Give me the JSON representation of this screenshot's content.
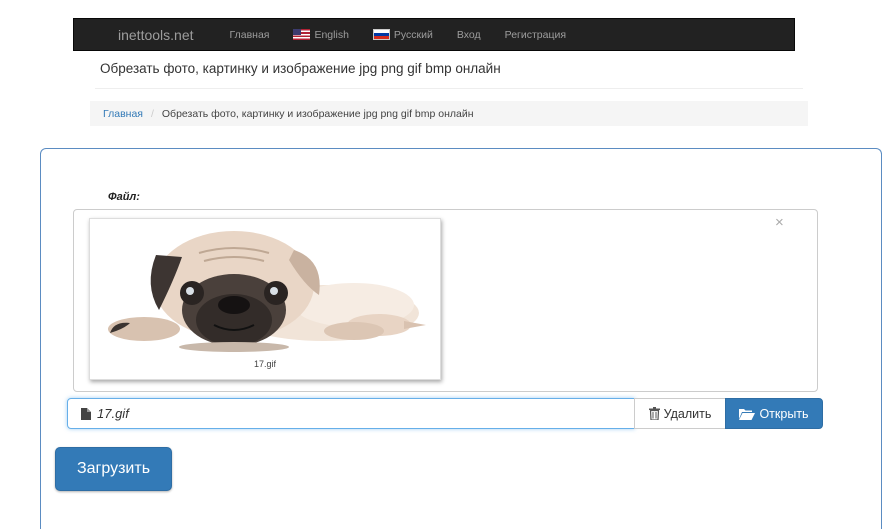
{
  "navbar": {
    "brand": "inettools.net",
    "items": [
      {
        "label": "Главная"
      },
      {
        "label": "English",
        "flag": "us-flag-icon"
      },
      {
        "label": "Русский",
        "flag": "ru-flag-icon"
      },
      {
        "label": "Вход"
      },
      {
        "label": "Регистрация"
      }
    ]
  },
  "page": {
    "title": "Обрезать фото, картинку и изображение jpg png gif bmp онлайн"
  },
  "breadcrumb": {
    "home": "Главная",
    "separator": "/",
    "current": "Обрезать фото, картинку и изображение jpg png gif bmp онлайн"
  },
  "form": {
    "file_label": "Файл:",
    "close_symbol": "×",
    "preview_caption": "17.gif",
    "file_name": "17.gif",
    "remove_label": "Удалить",
    "open_label": "Открыть",
    "upload_label": "Загрузить"
  },
  "colors": {
    "navbar_bg": "#222222",
    "primary": "#337ab7",
    "input_focus": "#66afe9"
  },
  "icons": {
    "file": "file-icon",
    "trash": "trash-icon",
    "folder": "folder-open-icon",
    "close": "close-icon"
  }
}
